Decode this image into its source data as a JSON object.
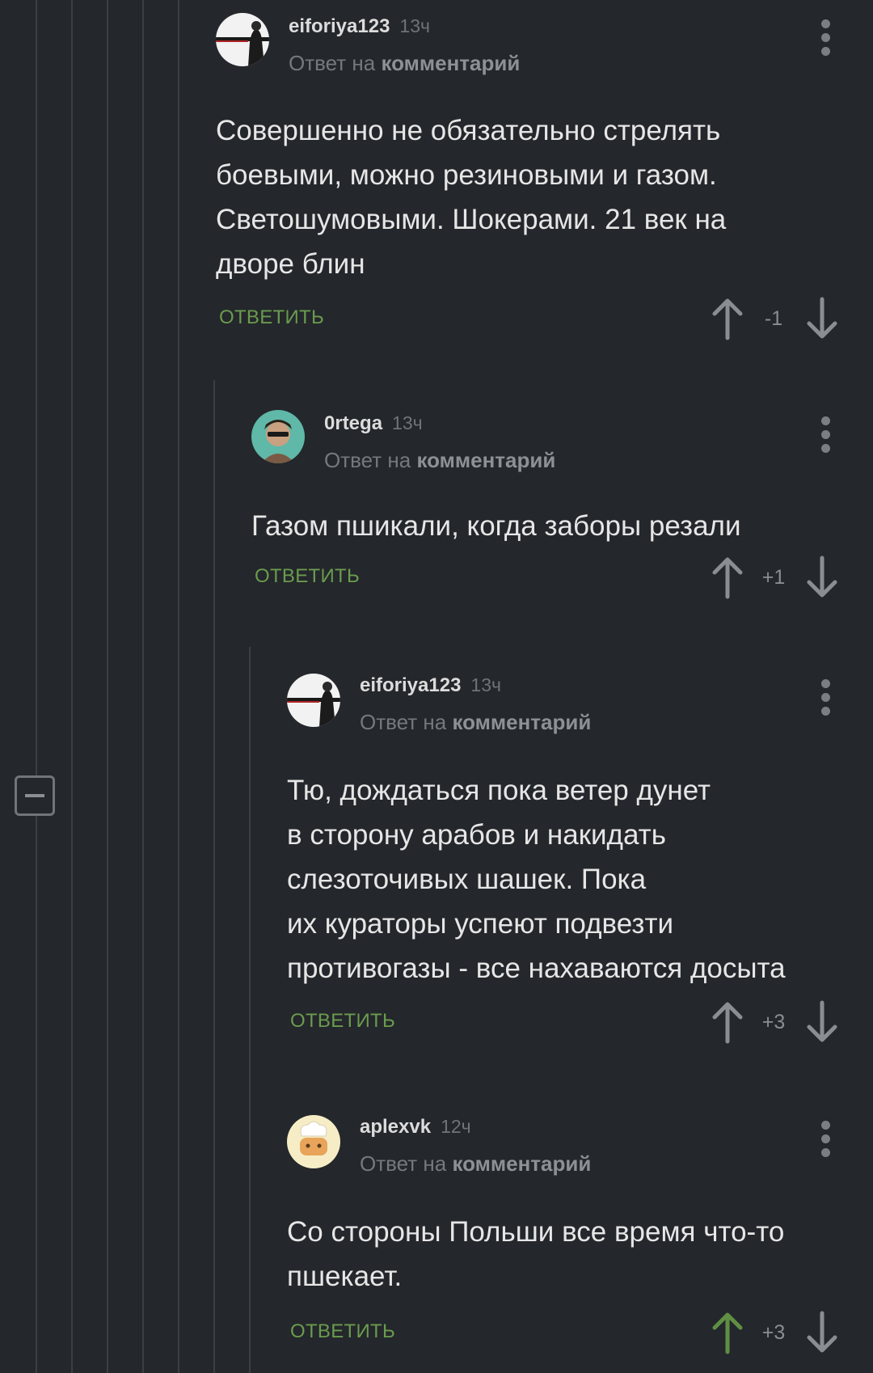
{
  "colors": {
    "background": "#24272b",
    "thread_line": "#3b3f44",
    "reply_green": "#6a9b4e",
    "upvote_active": "#5f8f43",
    "muted_text": "#75797e"
  },
  "collapse_button": {
    "icon": "minus-icon"
  },
  "comments": [
    {
      "username": "eiforiya123",
      "time": "13ч",
      "reply_prefix": "Ответ на",
      "reply_target": "комментарий",
      "lines": [
        "Совершенно не обязательно стрелять",
        "боевыми, можно резиновыми и газом.",
        "Светошумовыми. Шокерами. 21 век на",
        "дворе блин"
      ],
      "reply_label": "ОТВЕТИТЬ",
      "rating": "-1",
      "upvoted": false,
      "avatar_icon": "man-in-suit-avatar"
    },
    {
      "username": "0rtega",
      "time": "13ч",
      "reply_prefix": "Ответ на",
      "reply_target": "комментарий",
      "lines": [
        "Газом пшикали, когда заборы резали"
      ],
      "reply_label": "ОТВЕТИТЬ",
      "rating": "+1",
      "upvoted": false,
      "avatar_icon": "man-with-sunglasses-avatar"
    },
    {
      "username": "eiforiya123",
      "time": "13ч",
      "reply_prefix": "Ответ на",
      "reply_target": "комментарий",
      "lines": [
        "Тю, дождаться пока ветер дунет",
        "в сторону арабов и накидать",
        "слезоточивых шашек. Пока",
        "их кураторы успеют подвезти",
        "противогазы - все нахаваются досыта"
      ],
      "reply_label": "ОТВЕТИТЬ",
      "rating": "+3",
      "upvoted": false,
      "avatar_icon": "man-in-suit-avatar"
    },
    {
      "username": "aplexvk",
      "time": "12ч",
      "reply_prefix": "Ответ на",
      "reply_target": "комментарий",
      "lines": [
        "Со стороны Польши все время что-то",
        "пшекает."
      ],
      "reply_label": "ОТВЕТИТЬ",
      "rating": "+3",
      "upvoted": true,
      "avatar_icon": "cartoon-chef-avatar"
    }
  ]
}
